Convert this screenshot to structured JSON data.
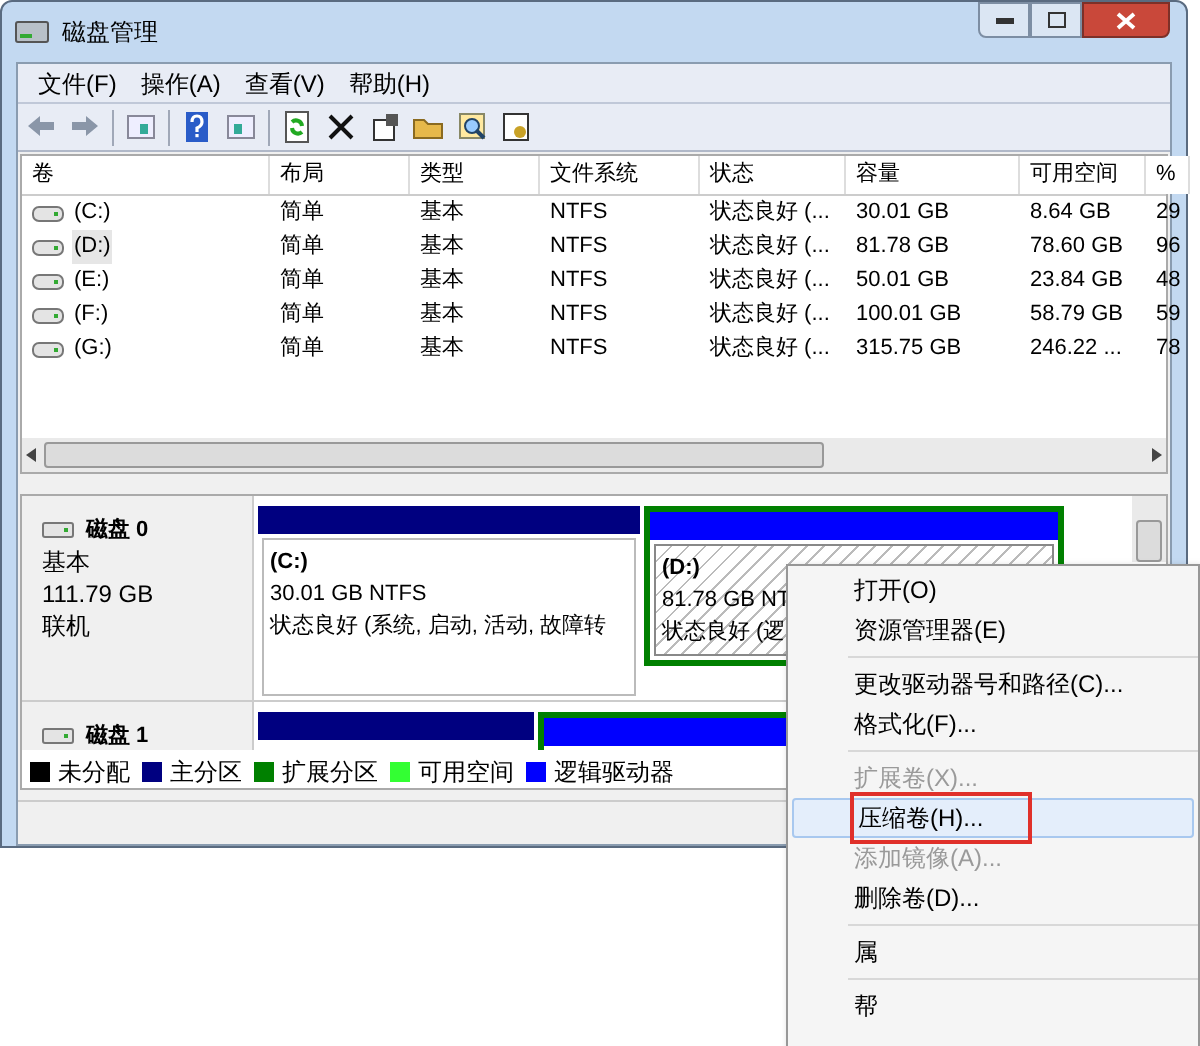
{
  "window": {
    "title": "磁盘管理"
  },
  "menu_bar": [
    "文件(F)",
    "操作(A)",
    "查看(V)",
    "帮助(H)"
  ],
  "volumes": {
    "columns": [
      "卷",
      "布局",
      "类型",
      "文件系统",
      "状态",
      "容量",
      "可用空间",
      "% "
    ],
    "rows": [
      {
        "cells": [
          "(C:)",
          "简单",
          "基本",
          "NTFS",
          "状态良好 (...",
          "30.01 GB",
          "8.64 GB",
          "29"
        ],
        "selected": false
      },
      {
        "cells": [
          "(D:)",
          "简单",
          "基本",
          "NTFS",
          "状态良好 (...",
          "81.78 GB",
          "78.60 GB",
          "96"
        ],
        "selected": true
      },
      {
        "cells": [
          "(E:)",
          "简单",
          "基本",
          "NTFS",
          "状态良好 (...",
          "50.01 GB",
          "23.84 GB",
          "48"
        ],
        "selected": false
      },
      {
        "cells": [
          "(F:)",
          "简单",
          "基本",
          "NTFS",
          "状态良好 (...",
          "100.01 GB",
          "58.79 GB",
          "59"
        ],
        "selected": false
      },
      {
        "cells": [
          "(G:)",
          "简单",
          "基本",
          "NTFS",
          "状态良好 (...",
          "315.75 GB",
          "246.22 ...",
          "78"
        ],
        "selected": false
      }
    ]
  },
  "disks": [
    {
      "name": "磁盘 0",
      "type": "基本",
      "size": "111.79 GB",
      "status": "联机",
      "partitions": [
        {
          "kind": "primary",
          "label": "(C:)",
          "size_fs": "30.01 GB NTFS",
          "status": "状态良好 (系统, 启动, 活动, 故障转",
          "selected": false
        },
        {
          "kind": "logical",
          "label": "(D:)",
          "size_fs": "81.78 GB NT",
          "status": "状态良好 (逻",
          "selected": true
        }
      ]
    },
    {
      "name": "磁盘 1",
      "partitions": [
        {
          "kind": "primary"
        },
        {
          "kind": "logical"
        }
      ]
    }
  ],
  "legend": [
    {
      "label": "未分配",
      "color": "#000000"
    },
    {
      "label": "主分区",
      "color": "#000080"
    },
    {
      "label": "扩展分区",
      "color": "#008000"
    },
    {
      "label": "可用空间",
      "color": "#33ff33"
    },
    {
      "label": "逻辑驱动器",
      "color": "#0000ff"
    }
  ],
  "context_menu": [
    {
      "kind": "item",
      "label": "打开(O)",
      "disabled": false,
      "selected": false
    },
    {
      "kind": "item",
      "label": "资源管理器(E)",
      "disabled": false,
      "selected": false
    },
    {
      "kind": "separator"
    },
    {
      "kind": "item",
      "label": "更改驱动器号和路径(C)...",
      "disabled": false,
      "selected": false
    },
    {
      "kind": "item",
      "label": "格式化(F)...",
      "disabled": false,
      "selected": false
    },
    {
      "kind": "separator"
    },
    {
      "kind": "item",
      "label": "扩展卷(X)...",
      "disabled": true,
      "selected": false
    },
    {
      "kind": "item",
      "label": "压缩卷(H)...",
      "disabled": false,
      "selected": true
    },
    {
      "kind": "item",
      "label": "添加镜像(A)...",
      "disabled": true,
      "selected": false
    },
    {
      "kind": "item",
      "label": "删除卷(D)...",
      "disabled": false,
      "selected": false
    },
    {
      "kind": "separator"
    },
    {
      "kind": "item",
      "label": "属",
      "disabled": false,
      "selected": false
    },
    {
      "kind": "separator"
    },
    {
      "kind": "item",
      "label": "帮",
      "disabled": false,
      "selected": false
    }
  ]
}
